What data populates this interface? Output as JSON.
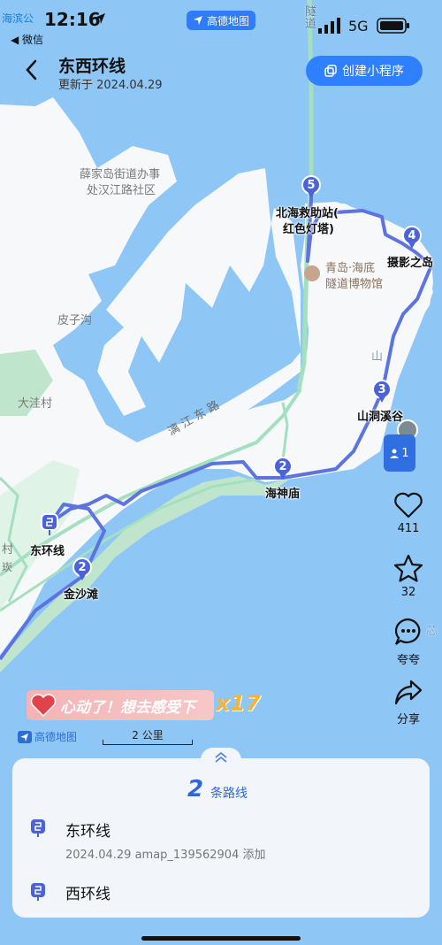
{
  "status_bar": {
    "time": "12:16",
    "back_app": "◀ 微信",
    "corner_label": "海滨公",
    "app_pill": "高德地图",
    "network": "5G"
  },
  "header": {
    "title": "东西环线",
    "updated": "更新于 2024.04.29",
    "mini_program_button": "创建小程序"
  },
  "map": {
    "area_labels": [
      "薛家岛街道办事",
      "处汉江路社区",
      "皮子沟",
      "大洼村",
      "村",
      "崁"
    ],
    "road_label": "漓 江 东 路",
    "poi": {
      "line1": "青岛·海底",
      "line2": "隧道博物馆"
    },
    "hill_label": "山",
    "tunnel_chars": [
      "隧",
      "道"
    ],
    "faint_label": "芯",
    "route_markers": [
      {
        "number": "5",
        "name_line1": "北海救助站(",
        "name_line2": "红色灯塔)"
      },
      {
        "number": "4",
        "name": "摄影之岛"
      },
      {
        "number": "3",
        "name": "山洞溪谷"
      },
      {
        "number": "2",
        "name": "海神庙"
      },
      {
        "number": "2",
        "name": "金沙滩"
      }
    ],
    "start_label": "东环线",
    "route_color": "#5d73e0",
    "pin_color": "#4a63d9",
    "land_color": "#f7f8fa",
    "water_color": "#8ec6f5",
    "park_color": "#bfe6cd",
    "road_green": "#a4e0bf"
  },
  "side_actions": {
    "users_count": "1",
    "like_count": "411",
    "star_count": "32",
    "comment_label": "夸夸",
    "share_label": "分享"
  },
  "promo": {
    "text": "心动了！想去感受下",
    "multiplier": "x17"
  },
  "map_footer": {
    "logo": "高德地图",
    "scale": "2 公里"
  },
  "sheet": {
    "route_count": "2",
    "route_count_label": "条路线",
    "routes": [
      {
        "name": "东环线",
        "meta": "2024.04.29 amap_139562904 添加",
        "icon": "route-pin-icon"
      },
      {
        "name": "西环线",
        "meta": "",
        "icon": "route-pin-icon"
      }
    ]
  }
}
